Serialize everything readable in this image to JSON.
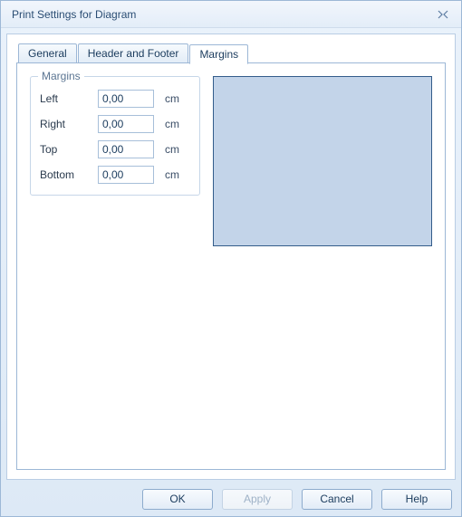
{
  "window": {
    "title": "Print Settings for Diagram"
  },
  "tabs": {
    "general": "General",
    "header_footer": "Header and Footer",
    "margins": "Margins"
  },
  "margins_group": {
    "title": "Margins",
    "left_label": "Left",
    "right_label": "Right",
    "top_label": "Top",
    "bottom_label": "Bottom",
    "left_value": "0,00",
    "right_value": "0,00",
    "top_value": "0,00",
    "bottom_value": "0,00",
    "unit": "cm"
  },
  "buttons": {
    "ok": "OK",
    "apply": "Apply",
    "cancel": "Cancel",
    "help": "Help"
  }
}
